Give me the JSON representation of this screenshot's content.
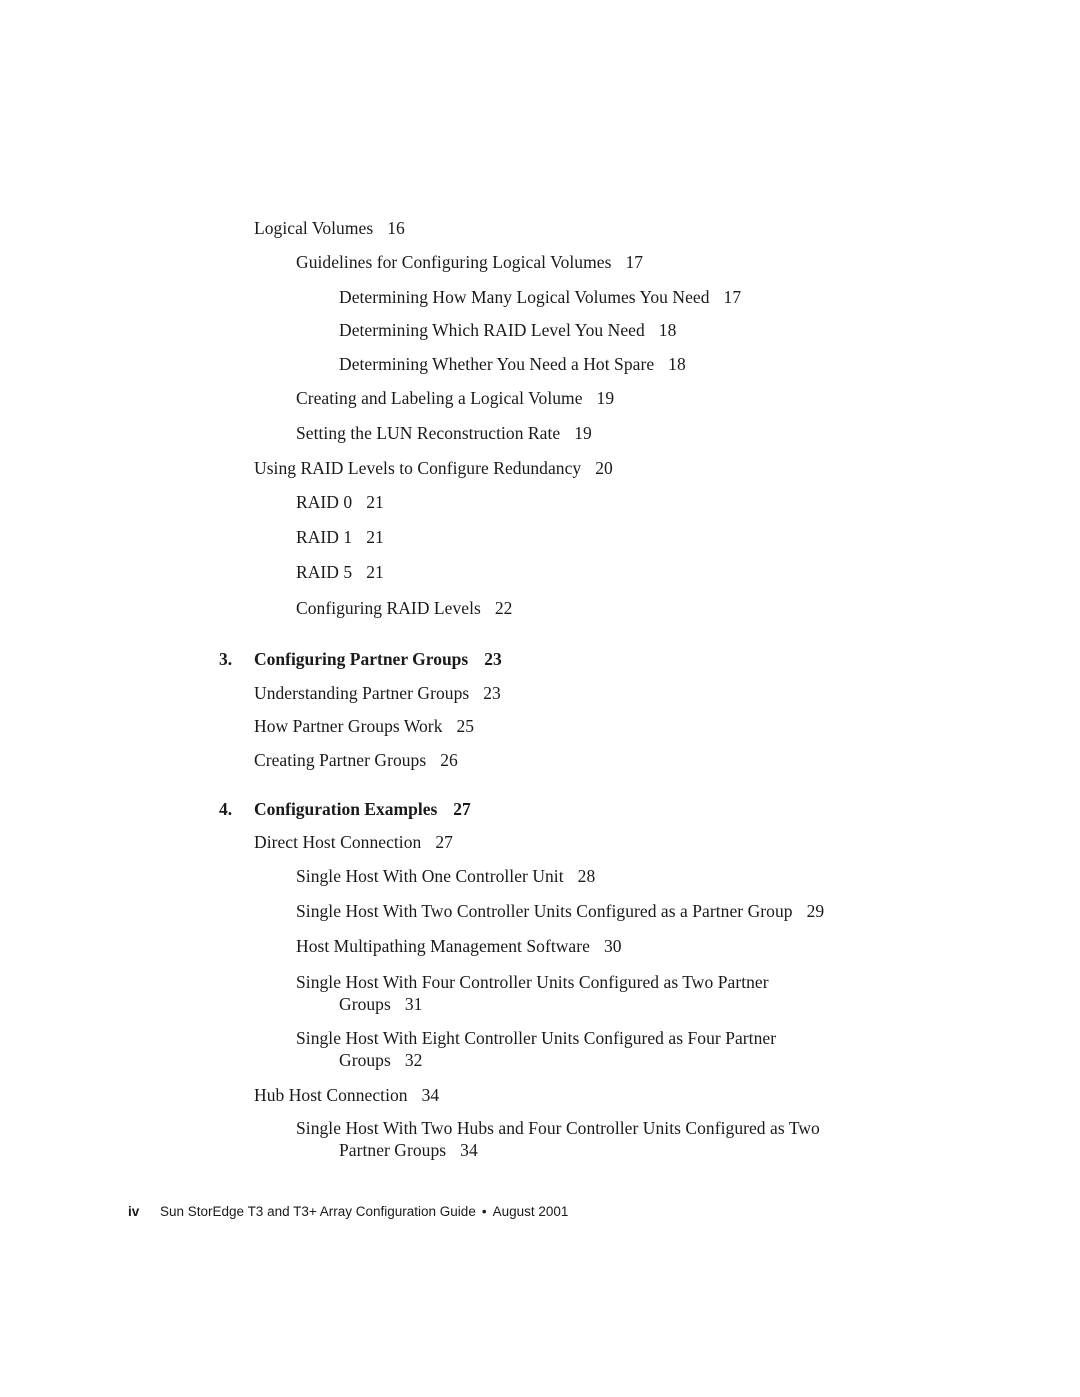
{
  "toc": {
    "entries": [
      {
        "title": "Logical Volumes",
        "page": "16"
      },
      {
        "title": "Guidelines for Configuring Logical Volumes",
        "page": "17"
      },
      {
        "title": "Determining How Many Logical Volumes You Need",
        "page": "17"
      },
      {
        "title": "Determining Which RAID Level You Need",
        "page": "18"
      },
      {
        "title": "Determining Whether You Need a Hot Spare",
        "page": "18"
      },
      {
        "title": "Creating and Labeling a Logical Volume",
        "page": "19"
      },
      {
        "title": "Setting the LUN Reconstruction Rate",
        "page": "19"
      },
      {
        "title": "Using RAID Levels to Configure Redundancy",
        "page": "20"
      },
      {
        "title": "RAID 0",
        "page": "21"
      },
      {
        "title": "RAID 1",
        "page": "21"
      },
      {
        "title": "RAID 5",
        "page": "21"
      },
      {
        "title": "Configuring RAID Levels",
        "page": "22"
      }
    ],
    "chapter3": {
      "number": "3.",
      "title": "Configuring Partner Groups",
      "page": "23",
      "entries": [
        {
          "title": "Understanding Partner Groups",
          "page": "23"
        },
        {
          "title": "How Partner Groups Work",
          "page": "25"
        },
        {
          "title": "Creating Partner Groups",
          "page": "26"
        }
      ]
    },
    "chapter4": {
      "number": "4.",
      "title": "Configuration Examples",
      "page": "27",
      "entries": [
        {
          "title": "Direct Host Connection",
          "page": "27"
        },
        {
          "title": "Single Host With One Controller Unit",
          "page": "28"
        },
        {
          "title": "Single Host With Two Controller Units Configured as a Partner Group",
          "page": "29"
        },
        {
          "title": "Host Multipathing Management Software",
          "page": "30"
        },
        {
          "title": "Single Host With Four Controller Units Configured as Two Partner",
          "title_cont": "Groups",
          "page": "31"
        },
        {
          "title": "Single Host With Eight Controller Units Configured as Four Partner",
          "title_cont": "Groups",
          "page": "32"
        },
        {
          "title": "Hub Host Connection",
          "page": "34"
        },
        {
          "title": "Single Host With Two Hubs and Four Controller Units Configured as Two",
          "title_cont": "Partner Groups",
          "page": "34"
        }
      ]
    }
  },
  "footer": {
    "folio": "iv",
    "book_title": "Sun StorEdge T3 and T3+ Array Configuration Guide",
    "separator": "•",
    "date": "August 2001"
  }
}
